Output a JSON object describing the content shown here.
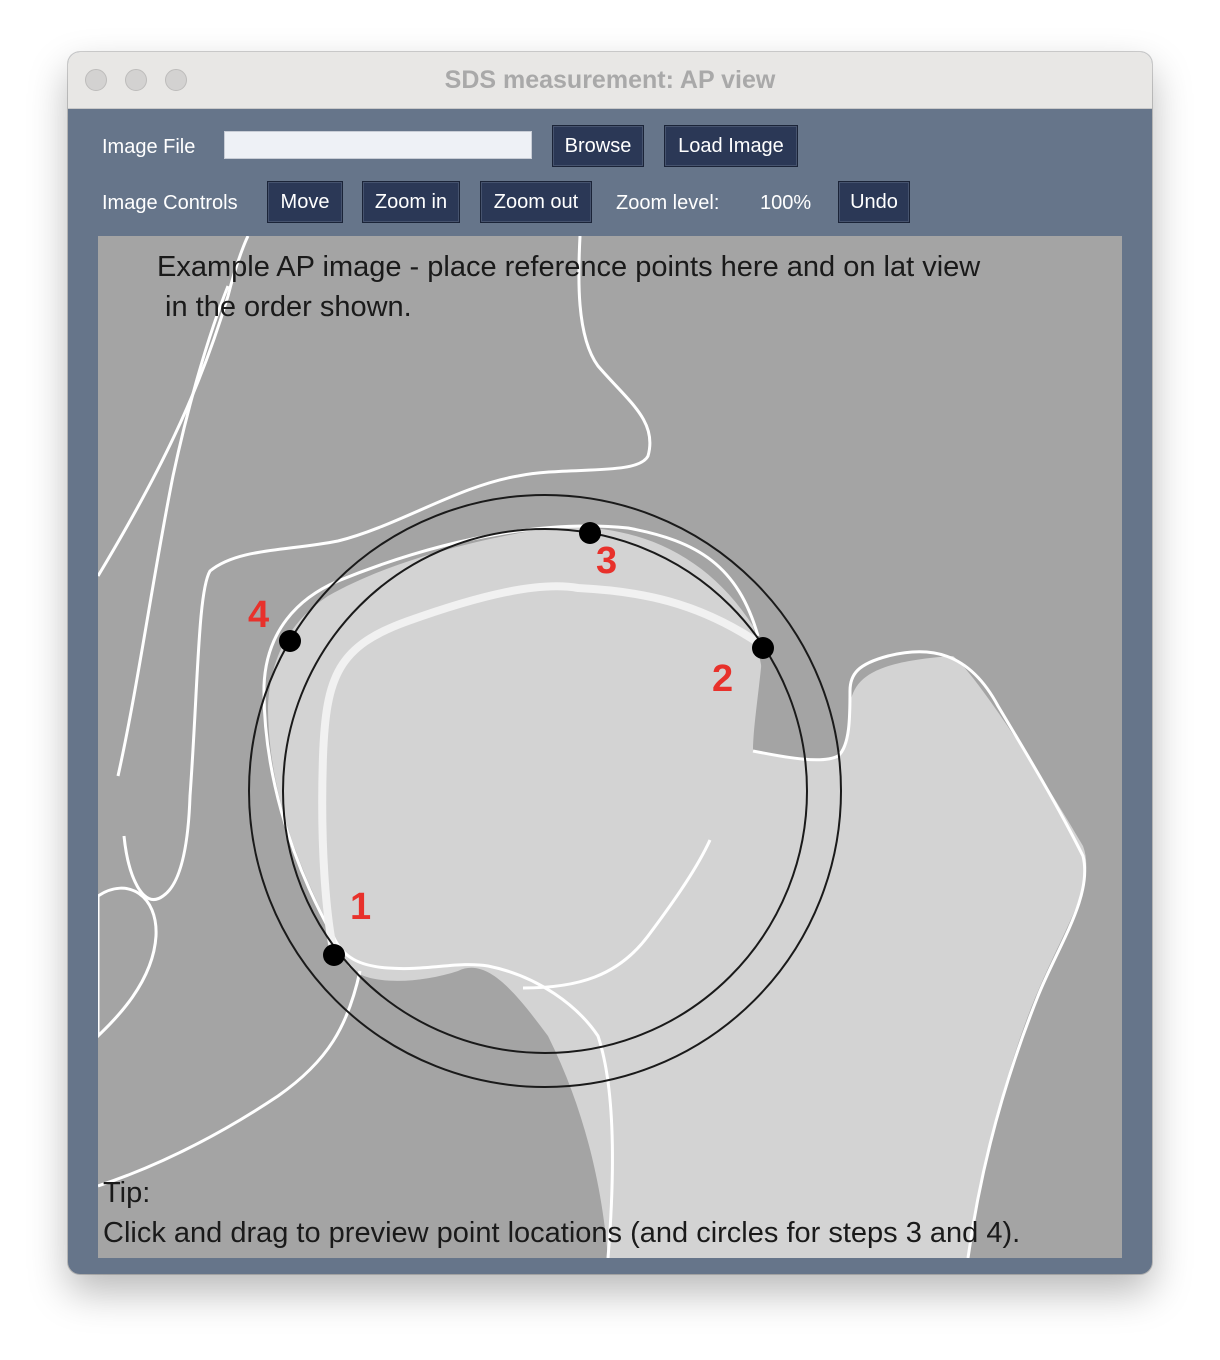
{
  "window": {
    "title": "SDS measurement: AP view"
  },
  "toolbar": {
    "image_file_label": "Image File",
    "file_value": "",
    "browse_label": "Browse",
    "load_label": "Load Image",
    "image_controls_label": "Image Controls",
    "move_label": "Move",
    "zoom_in_label": "Zoom in",
    "zoom_out_label": "Zoom out",
    "zoom_level_label": "Zoom level:",
    "zoom_level_value": "100%",
    "undo_label": "Undo"
  },
  "canvas": {
    "instruction_line1": "Example AP image - place reference points here and on lat view",
    "instruction_line2": " in the order shown.",
    "tip_title": "Tip:",
    "tip_text": "Click and drag to preview point locations (and circles for steps 3 and 4).",
    "point_labels": [
      "1",
      "2",
      "3",
      "4"
    ],
    "colors": {
      "background": "#a4a4a4",
      "bone": "#d3d3d3",
      "outline": "#ffffff",
      "point": "#000000",
      "label": "#e8312b"
    }
  }
}
